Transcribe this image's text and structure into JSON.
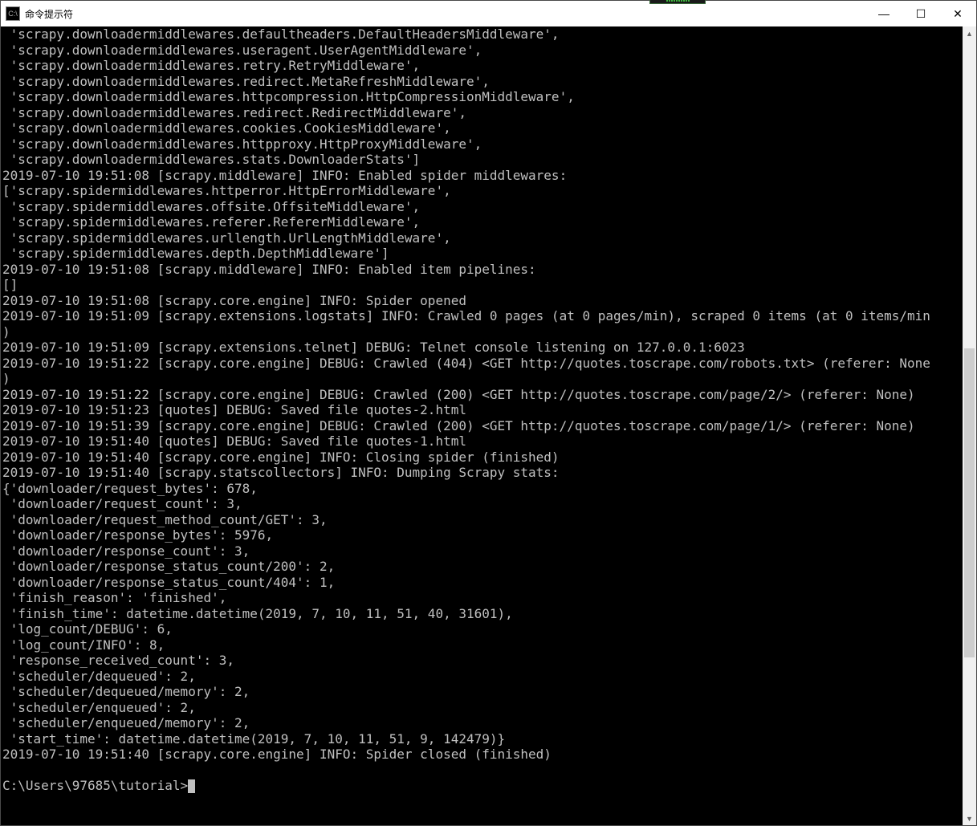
{
  "window": {
    "title": "命令提示符",
    "icon_label": "C:\\",
    "controls": {
      "min": "—",
      "max": "☐",
      "close": "✕"
    }
  },
  "terminal": {
    "lines": [
      " 'scrapy.downloadermiddlewares.defaultheaders.DefaultHeadersMiddleware',",
      " 'scrapy.downloadermiddlewares.useragent.UserAgentMiddleware',",
      " 'scrapy.downloadermiddlewares.retry.RetryMiddleware',",
      " 'scrapy.downloadermiddlewares.redirect.MetaRefreshMiddleware',",
      " 'scrapy.downloadermiddlewares.httpcompression.HttpCompressionMiddleware',",
      " 'scrapy.downloadermiddlewares.redirect.RedirectMiddleware',",
      " 'scrapy.downloadermiddlewares.cookies.CookiesMiddleware',",
      " 'scrapy.downloadermiddlewares.httpproxy.HttpProxyMiddleware',",
      " 'scrapy.downloadermiddlewares.stats.DownloaderStats']",
      "2019-07-10 19:51:08 [scrapy.middleware] INFO: Enabled spider middlewares:",
      "['scrapy.spidermiddlewares.httperror.HttpErrorMiddleware',",
      " 'scrapy.spidermiddlewares.offsite.OffsiteMiddleware',",
      " 'scrapy.spidermiddlewares.referer.RefererMiddleware',",
      " 'scrapy.spidermiddlewares.urllength.UrlLengthMiddleware',",
      " 'scrapy.spidermiddlewares.depth.DepthMiddleware']",
      "2019-07-10 19:51:08 [scrapy.middleware] INFO: Enabled item pipelines:",
      "[]",
      "2019-07-10 19:51:08 [scrapy.core.engine] INFO: Spider opened",
      "2019-07-10 19:51:09 [scrapy.extensions.logstats] INFO: Crawled 0 pages (at 0 pages/min), scraped 0 items (at 0 items/min",
      ")",
      "2019-07-10 19:51:09 [scrapy.extensions.telnet] DEBUG: Telnet console listening on 127.0.0.1:6023",
      "2019-07-10 19:51:22 [scrapy.core.engine] DEBUG: Crawled (404) <GET http://quotes.toscrape.com/robots.txt> (referer: None",
      ")",
      "2019-07-10 19:51:22 [scrapy.core.engine] DEBUG: Crawled (200) <GET http://quotes.toscrape.com/page/2/> (referer: None)",
      "2019-07-10 19:51:23 [quotes] DEBUG: Saved file quotes-2.html",
      "2019-07-10 19:51:39 [scrapy.core.engine] DEBUG: Crawled (200) <GET http://quotes.toscrape.com/page/1/> (referer: None)",
      "2019-07-10 19:51:40 [quotes] DEBUG: Saved file quotes-1.html",
      "2019-07-10 19:51:40 [scrapy.core.engine] INFO: Closing spider (finished)",
      "2019-07-10 19:51:40 [scrapy.statscollectors] INFO: Dumping Scrapy stats:",
      "{'downloader/request_bytes': 678,",
      " 'downloader/request_count': 3,",
      " 'downloader/request_method_count/GET': 3,",
      " 'downloader/response_bytes': 5976,",
      " 'downloader/response_count': 3,",
      " 'downloader/response_status_count/200': 2,",
      " 'downloader/response_status_count/404': 1,",
      " 'finish_reason': 'finished',",
      " 'finish_time': datetime.datetime(2019, 7, 10, 11, 51, 40, 31601),",
      " 'log_count/DEBUG': 6,",
      " 'log_count/INFO': 8,",
      " 'response_received_count': 3,",
      " 'scheduler/dequeued': 2,",
      " 'scheduler/dequeued/memory': 2,",
      " 'scheduler/enqueued': 2,",
      " 'scheduler/enqueued/memory': 2,",
      " 'start_time': datetime.datetime(2019, 7, 10, 11, 51, 9, 142479)}",
      "2019-07-10 19:51:40 [scrapy.core.engine] INFO: Spider closed (finished)",
      "",
      "C:\\Users\\97685\\tutorial>"
    ]
  }
}
